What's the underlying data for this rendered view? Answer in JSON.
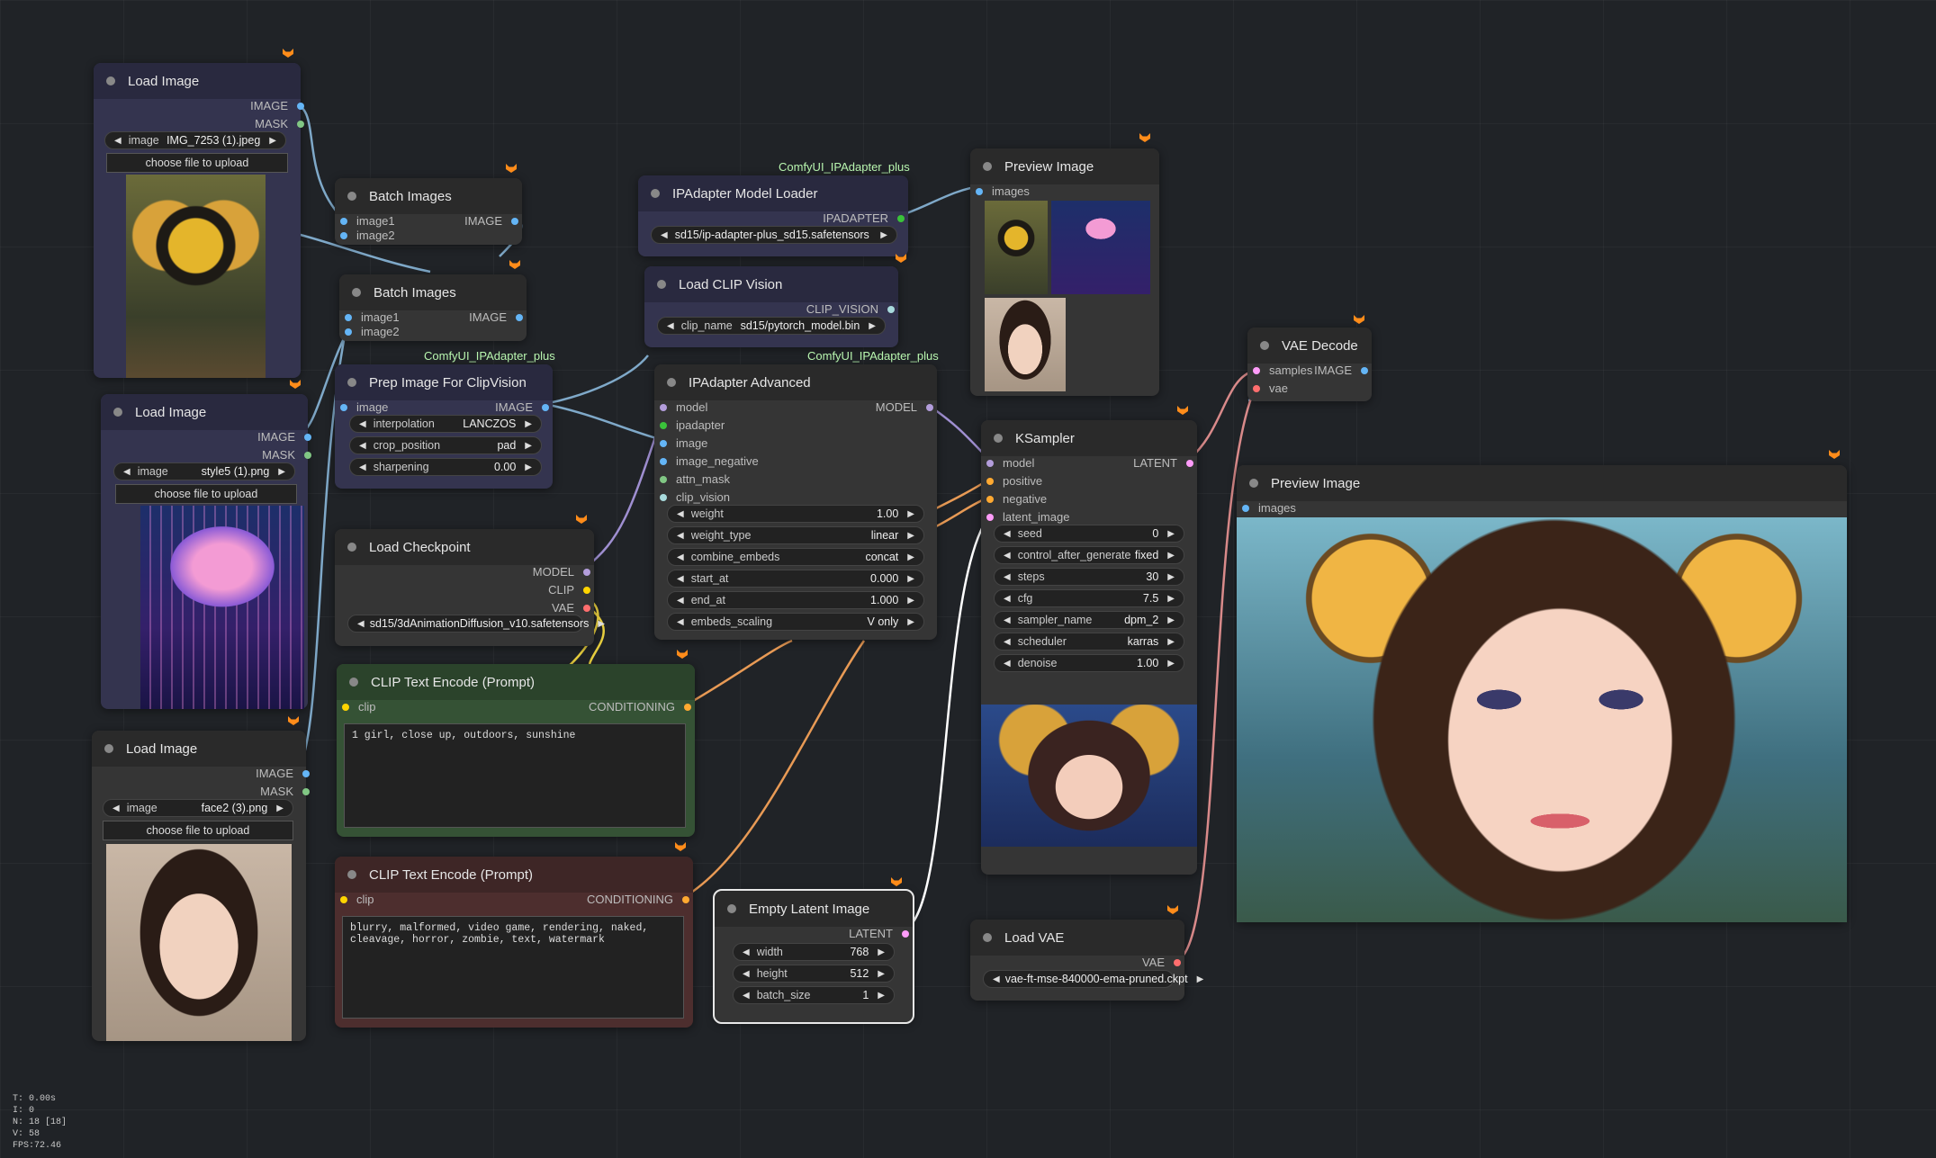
{
  "node_types": [
    "Load Image",
    "Batch Images",
    "Prep Image For ClipVision",
    "Load Checkpoint",
    "CLIP Text Encode (Prompt)",
    "IPAdapter Model Loader",
    "Load CLIP Vision",
    "IPAdapter Advanced",
    "Empty Latent Image",
    "Preview Image",
    "KSampler",
    "Load VAE",
    "VAE Decode"
  ],
  "nodes": {
    "load_image_1": {
      "title": "Load Image",
      "outputs": [
        "IMAGE",
        "MASK"
      ],
      "image": "IMG_7253 (1).jpeg",
      "upload": "choose file to upload"
    },
    "load_image_2": {
      "title": "Load Image",
      "outputs": [
        "IMAGE",
        "MASK"
      ],
      "image": "style5 (1).png",
      "upload": "choose file to upload"
    },
    "load_image_3": {
      "title": "Load Image",
      "outputs": [
        "IMAGE",
        "MASK"
      ],
      "image": "face2 (3).png",
      "upload": "choose file to upload"
    },
    "batch_1": {
      "title": "Batch Images",
      "inputs": [
        "image1",
        "image2"
      ],
      "output": "IMAGE"
    },
    "batch_2": {
      "title": "Batch Images",
      "inputs": [
        "image1",
        "image2"
      ],
      "output": "IMAGE"
    },
    "prep": {
      "title": "Prep Image For ClipVision",
      "pack": "ComfyUI_IPAdapter_plus",
      "input": "image",
      "output": "IMAGE",
      "widgets": [
        {
          "label": "interpolation",
          "value": "LANCZOS"
        },
        {
          "label": "crop_position",
          "value": "pad"
        },
        {
          "label": "sharpening",
          "value": "0.00"
        }
      ]
    },
    "checkpoint": {
      "title": "Load Checkpoint",
      "outputs": [
        "MODEL",
        "CLIP",
        "VAE"
      ],
      "ckpt": "sd15/3dAnimationDiffusion_v10.safetensors"
    },
    "clip_pos": {
      "title": "CLIP Text Encode (Prompt)",
      "input": "clip",
      "output": "CONDITIONING",
      "text": "1 girl, close up, outdoors, sunshine"
    },
    "clip_neg": {
      "title": "CLIP Text Encode (Prompt)",
      "input": "clip",
      "output": "CONDITIONING",
      "text": "blurry, malformed, video game, rendering, naked, cleavage, horror, zombie, text, watermark"
    },
    "ipa_loader": {
      "title": "IPAdapter Model Loader",
      "pack": "ComfyUI_IPAdapter_plus",
      "output": "IPADAPTER",
      "value": "sd15/ip-adapter-plus_sd15.safetensors"
    },
    "clip_vision": {
      "title": "Load CLIP Vision",
      "output": "CLIP_VISION",
      "label": "clip_name",
      "value": "sd15/pytorch_model.bin"
    },
    "ipa_adv": {
      "title": "IPAdapter Advanced",
      "pack": "ComfyUI_IPAdapter_plus",
      "inputs": [
        "model",
        "ipadapter",
        "image",
        "image_negative",
        "attn_mask",
        "clip_vision"
      ],
      "output": "MODEL",
      "widgets": [
        {
          "label": "weight",
          "value": "1.00"
        },
        {
          "label": "weight_type",
          "value": "linear"
        },
        {
          "label": "combine_embeds",
          "value": "concat"
        },
        {
          "label": "start_at",
          "value": "0.000"
        },
        {
          "label": "end_at",
          "value": "1.000"
        },
        {
          "label": "embeds_scaling",
          "value": "V only"
        }
      ]
    },
    "empty_latent": {
      "title": "Empty Latent Image",
      "output": "LATENT",
      "widgets": [
        {
          "label": "width",
          "value": "768"
        },
        {
          "label": "height",
          "value": "512"
        },
        {
          "label": "batch_size",
          "value": "1"
        }
      ]
    },
    "preview_1": {
      "title": "Preview Image",
      "input": "images"
    },
    "ksampler": {
      "title": "KSampler",
      "inputs": [
        "model",
        "positive",
        "negative",
        "latent_image"
      ],
      "output": "LATENT",
      "widgets": [
        {
          "label": "seed",
          "value": "0"
        },
        {
          "label": "control_after_generate",
          "value": "fixed"
        },
        {
          "label": "steps",
          "value": "30"
        },
        {
          "label": "cfg",
          "value": "7.5"
        },
        {
          "label": "sampler_name",
          "value": "dpm_2"
        },
        {
          "label": "scheduler",
          "value": "karras"
        },
        {
          "label": "denoise",
          "value": "1.00"
        }
      ]
    },
    "load_vae": {
      "title": "Load VAE",
      "output": "VAE",
      "value": "vae-ft-mse-840000-ema-pruned.ckpt"
    },
    "vae_decode": {
      "title": "VAE Decode",
      "inputs": [
        "samples",
        "vae"
      ],
      "output": "IMAGE"
    },
    "preview_2": {
      "title": "Preview Image",
      "input": "images"
    }
  },
  "stats": {
    "t": "T: 0.00s",
    "i": "I: 0",
    "n": "N: 18 [18]",
    "v": "V: 58",
    "fps": "FPS:72.46"
  },
  "colors": {
    "image": "#64b5f6",
    "mask": "#81c784",
    "model": "#b39ddb",
    "clip": "#ffd500",
    "vae": "#ff6e6e",
    "conditioning": "#ffa931",
    "latent": "#ff9cf9",
    "ipadapter": "#3ac23a",
    "clip_vision": "#a8dadc"
  }
}
